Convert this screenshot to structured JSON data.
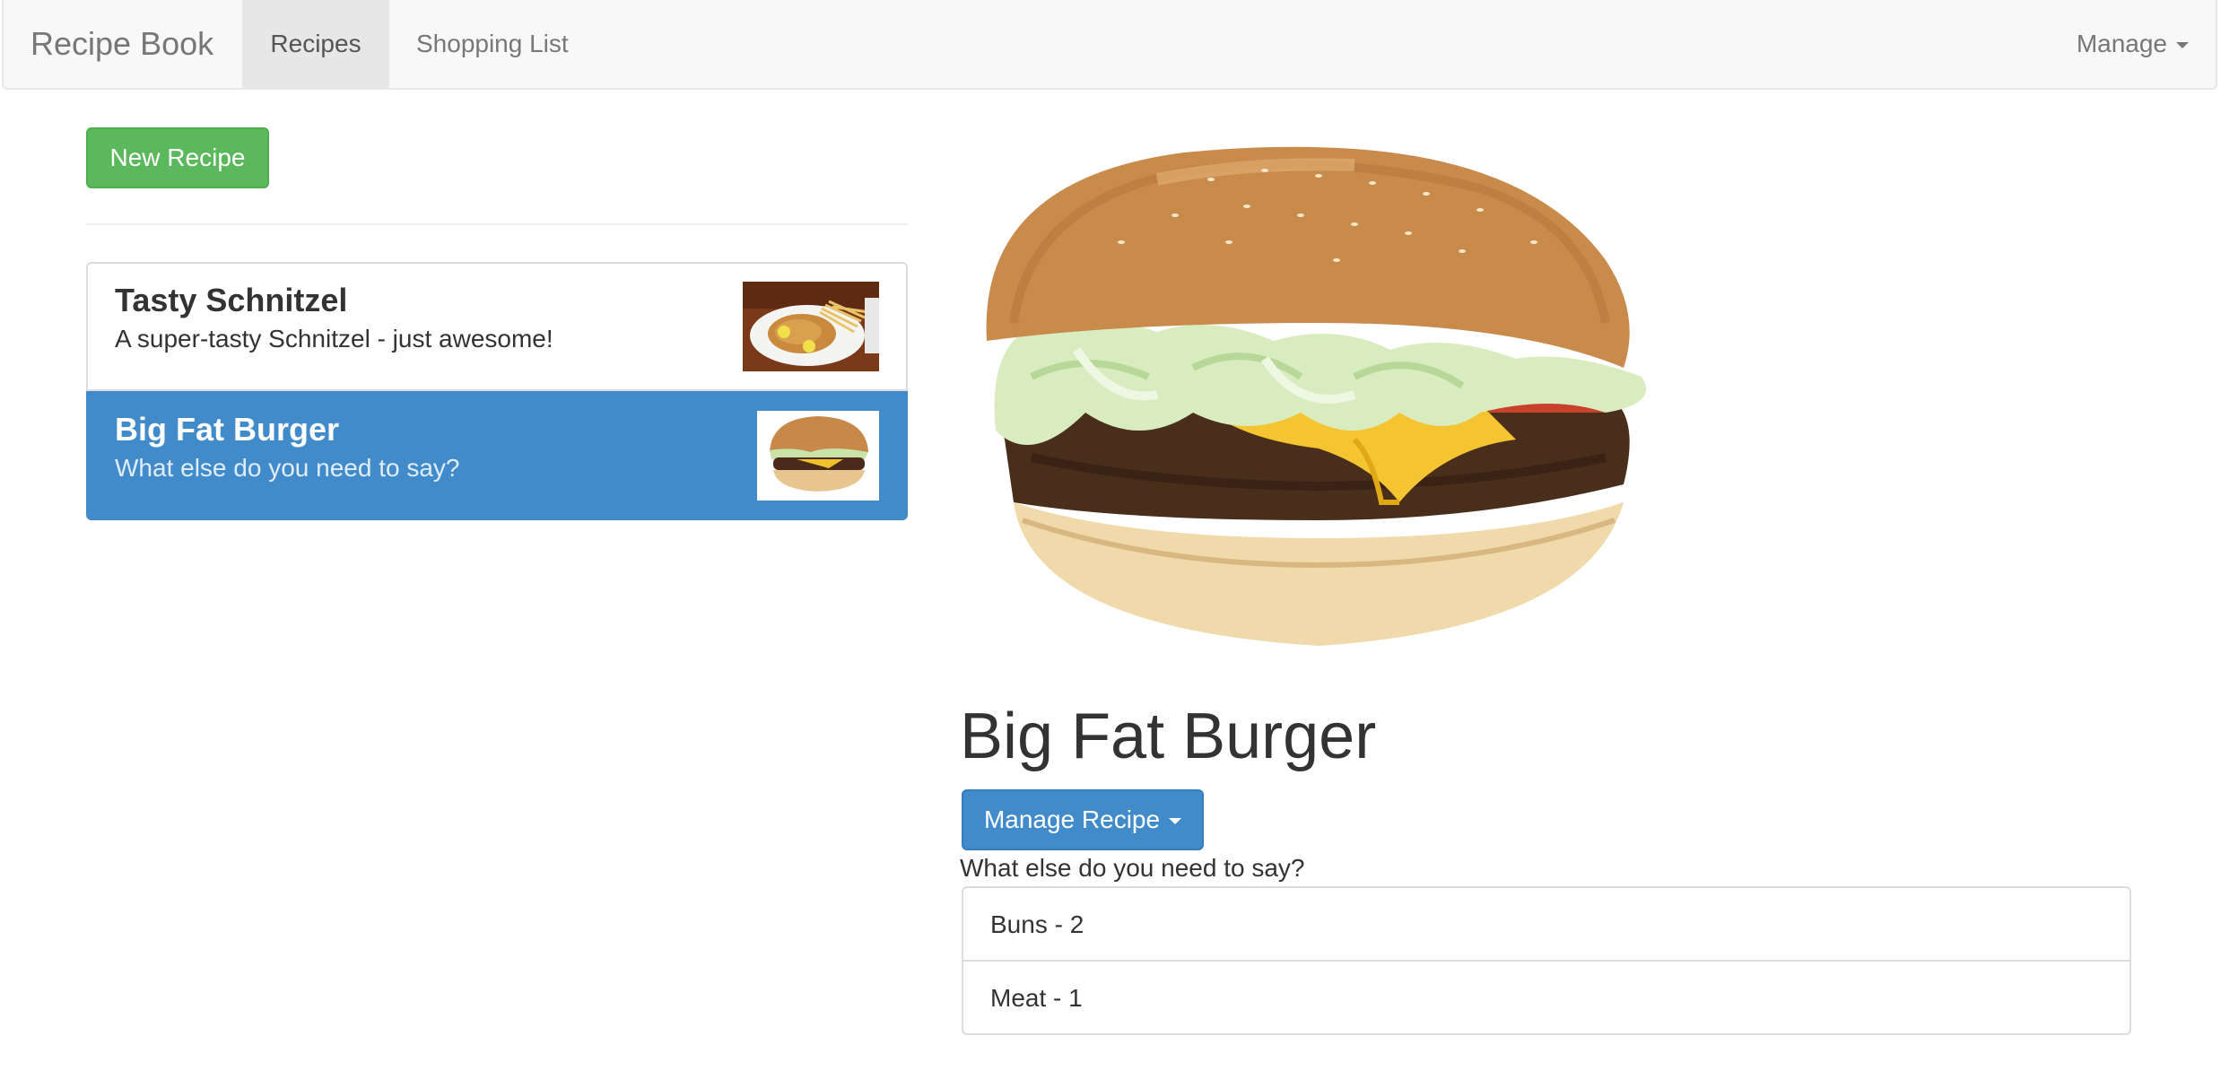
{
  "navbar": {
    "brand": "Recipe Book",
    "tabs": [
      {
        "label": "Recipes",
        "active": true
      },
      {
        "label": "Shopping List",
        "active": false
      }
    ],
    "manage_label": "Manage"
  },
  "sidebar": {
    "new_recipe_label": "New Recipe",
    "recipes": [
      {
        "name": "Tasty Schnitzel",
        "description": "A super-tasty Schnitzel - just awesome!",
        "selected": false
      },
      {
        "name": "Big Fat Burger",
        "description": "What else do you need to say?",
        "selected": true
      }
    ]
  },
  "detail": {
    "title": "Big Fat Burger",
    "manage_recipe_label": "Manage Recipe",
    "description": "What else do you need to say?",
    "ingredients": [
      "Buns - 2",
      "Meat - 1"
    ]
  },
  "colors": {
    "success": "#5cb85c",
    "primary": "#428bca",
    "navbar_bg": "#f8f8f8"
  }
}
